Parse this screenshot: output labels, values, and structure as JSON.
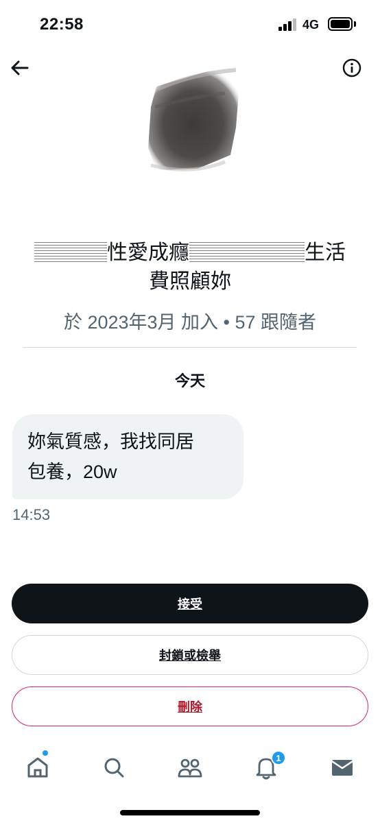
{
  "status_bar": {
    "time": "22:58",
    "network": "4G",
    "icons": [
      "signal-icon",
      "battery-icon"
    ]
  },
  "header": {
    "back_icon": "back-arrow-icon",
    "info_icon": "info-icon"
  },
  "profile": {
    "name_part1": "性愛成癮",
    "name_part2": "生活",
    "name_part3": "費照顧妳",
    "joined": "於 2023年3月 加入",
    "separator": "•",
    "followers": "57 跟隨者"
  },
  "conversation": {
    "date_separator": "今天",
    "message": {
      "line1": "妳氣質感，我找同居",
      "line2": "包養，20w",
      "time": "14:53"
    }
  },
  "actions": {
    "accept": "接受",
    "block_report": "封鎖或檢舉",
    "delete": "刪除"
  },
  "bottom_nav": {
    "items": [
      "home-icon",
      "search-icon",
      "communities-icon",
      "notifications-icon",
      "messages-icon"
    ],
    "notification_badge": "1"
  },
  "colors": {
    "accent": "#1d9bf0",
    "danger": "#e0245e",
    "text_primary": "#0f1419",
    "text_secondary": "#536471",
    "bubble_bg": "#eff3f4"
  }
}
